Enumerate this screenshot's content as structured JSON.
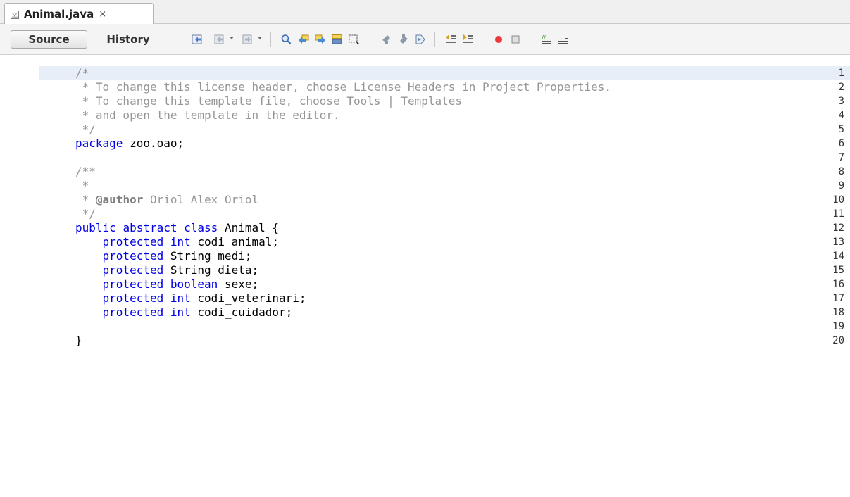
{
  "tab": {
    "title": "Animal.java",
    "close_glyph": "×"
  },
  "toolbar": {
    "source_label": "Source",
    "history_label": "History",
    "icons": [
      "last-edit-icon",
      "back-icon",
      "forward-icon",
      "find-selection-icon",
      "find-previous-icon",
      "find-next-icon",
      "toggle-highlight-icon",
      "toggle-rect-select-icon",
      "previous-bookmark-icon",
      "next-bookmark-icon",
      "toggle-bookmark-icon",
      "shift-left-icon",
      "shift-right-icon",
      "start-macro-icon",
      "stop-macro-icon",
      "comment-icon",
      "uncomment-icon"
    ]
  },
  "editor": {
    "line_numbers": [
      "1",
      "2",
      "3",
      "4",
      "5",
      "6",
      "7",
      "8",
      "9",
      "10",
      "11",
      "12",
      "13",
      "14",
      "15",
      "16",
      "17",
      "18",
      "19",
      "20"
    ],
    "lines": [
      [
        {
          "t": "/*",
          "k": "comment"
        }
      ],
      [
        {
          "t": " * To change this license header, choose License Headers in Project Properties.",
          "k": "comment"
        }
      ],
      [
        {
          "t": " * To change this template file, choose Tools | Templates",
          "k": "comment"
        }
      ],
      [
        {
          "t": " * and open the template in the editor.",
          "k": "comment"
        }
      ],
      [
        {
          "t": " */",
          "k": "comment"
        }
      ],
      [
        {
          "t": "package",
          "k": "kw"
        },
        {
          "t": " zoo.oao;",
          "k": "plain"
        }
      ],
      [],
      [
        {
          "t": "/**",
          "k": "comment"
        }
      ],
      [
        {
          "t": " *",
          "k": "comment"
        }
      ],
      [
        {
          "t": " * ",
          "k": "comment"
        },
        {
          "t": "@author",
          "k": "tag"
        },
        {
          "t": " Oriol Alex Oriol",
          "k": "comment"
        }
      ],
      [
        {
          "t": " */",
          "k": "comment"
        }
      ],
      [
        {
          "t": "public",
          "k": "kw"
        },
        {
          "t": " ",
          "k": "plain"
        },
        {
          "t": "abstract",
          "k": "kw"
        },
        {
          "t": " ",
          "k": "plain"
        },
        {
          "t": "class",
          "k": "kw"
        },
        {
          "t": " Animal {",
          "k": "plain"
        }
      ],
      [
        {
          "t": "    ",
          "k": "plain"
        },
        {
          "t": "protected",
          "k": "kw"
        },
        {
          "t": " ",
          "k": "plain"
        },
        {
          "t": "int",
          "k": "kw"
        },
        {
          "t": " codi_animal;",
          "k": "plain"
        }
      ],
      [
        {
          "t": "    ",
          "k": "plain"
        },
        {
          "t": "protected",
          "k": "kw"
        },
        {
          "t": " String medi;",
          "k": "plain"
        }
      ],
      [
        {
          "t": "    ",
          "k": "plain"
        },
        {
          "t": "protected",
          "k": "kw"
        },
        {
          "t": " String dieta;",
          "k": "plain"
        }
      ],
      [
        {
          "t": "    ",
          "k": "plain"
        },
        {
          "t": "protected",
          "k": "kw"
        },
        {
          "t": " ",
          "k": "plain"
        },
        {
          "t": "boolean",
          "k": "kw"
        },
        {
          "t": " sexe;",
          "k": "plain"
        }
      ],
      [
        {
          "t": "    ",
          "k": "plain"
        },
        {
          "t": "protected",
          "k": "kw"
        },
        {
          "t": " ",
          "k": "plain"
        },
        {
          "t": "int",
          "k": "kw"
        },
        {
          "t": " codi_veterinari;",
          "k": "plain"
        }
      ],
      [
        {
          "t": "    ",
          "k": "plain"
        },
        {
          "t": "protected",
          "k": "kw"
        },
        {
          "t": " ",
          "k": "plain"
        },
        {
          "t": "int",
          "k": "kw"
        },
        {
          "t": " codi_cuidador;",
          "k": "plain"
        }
      ],
      [],
      [
        {
          "t": "}",
          "k": "plain"
        }
      ]
    ]
  },
  "colors": {
    "keyword": "#0000e6",
    "comment": "#969696",
    "record_red": "#e83a3a"
  }
}
